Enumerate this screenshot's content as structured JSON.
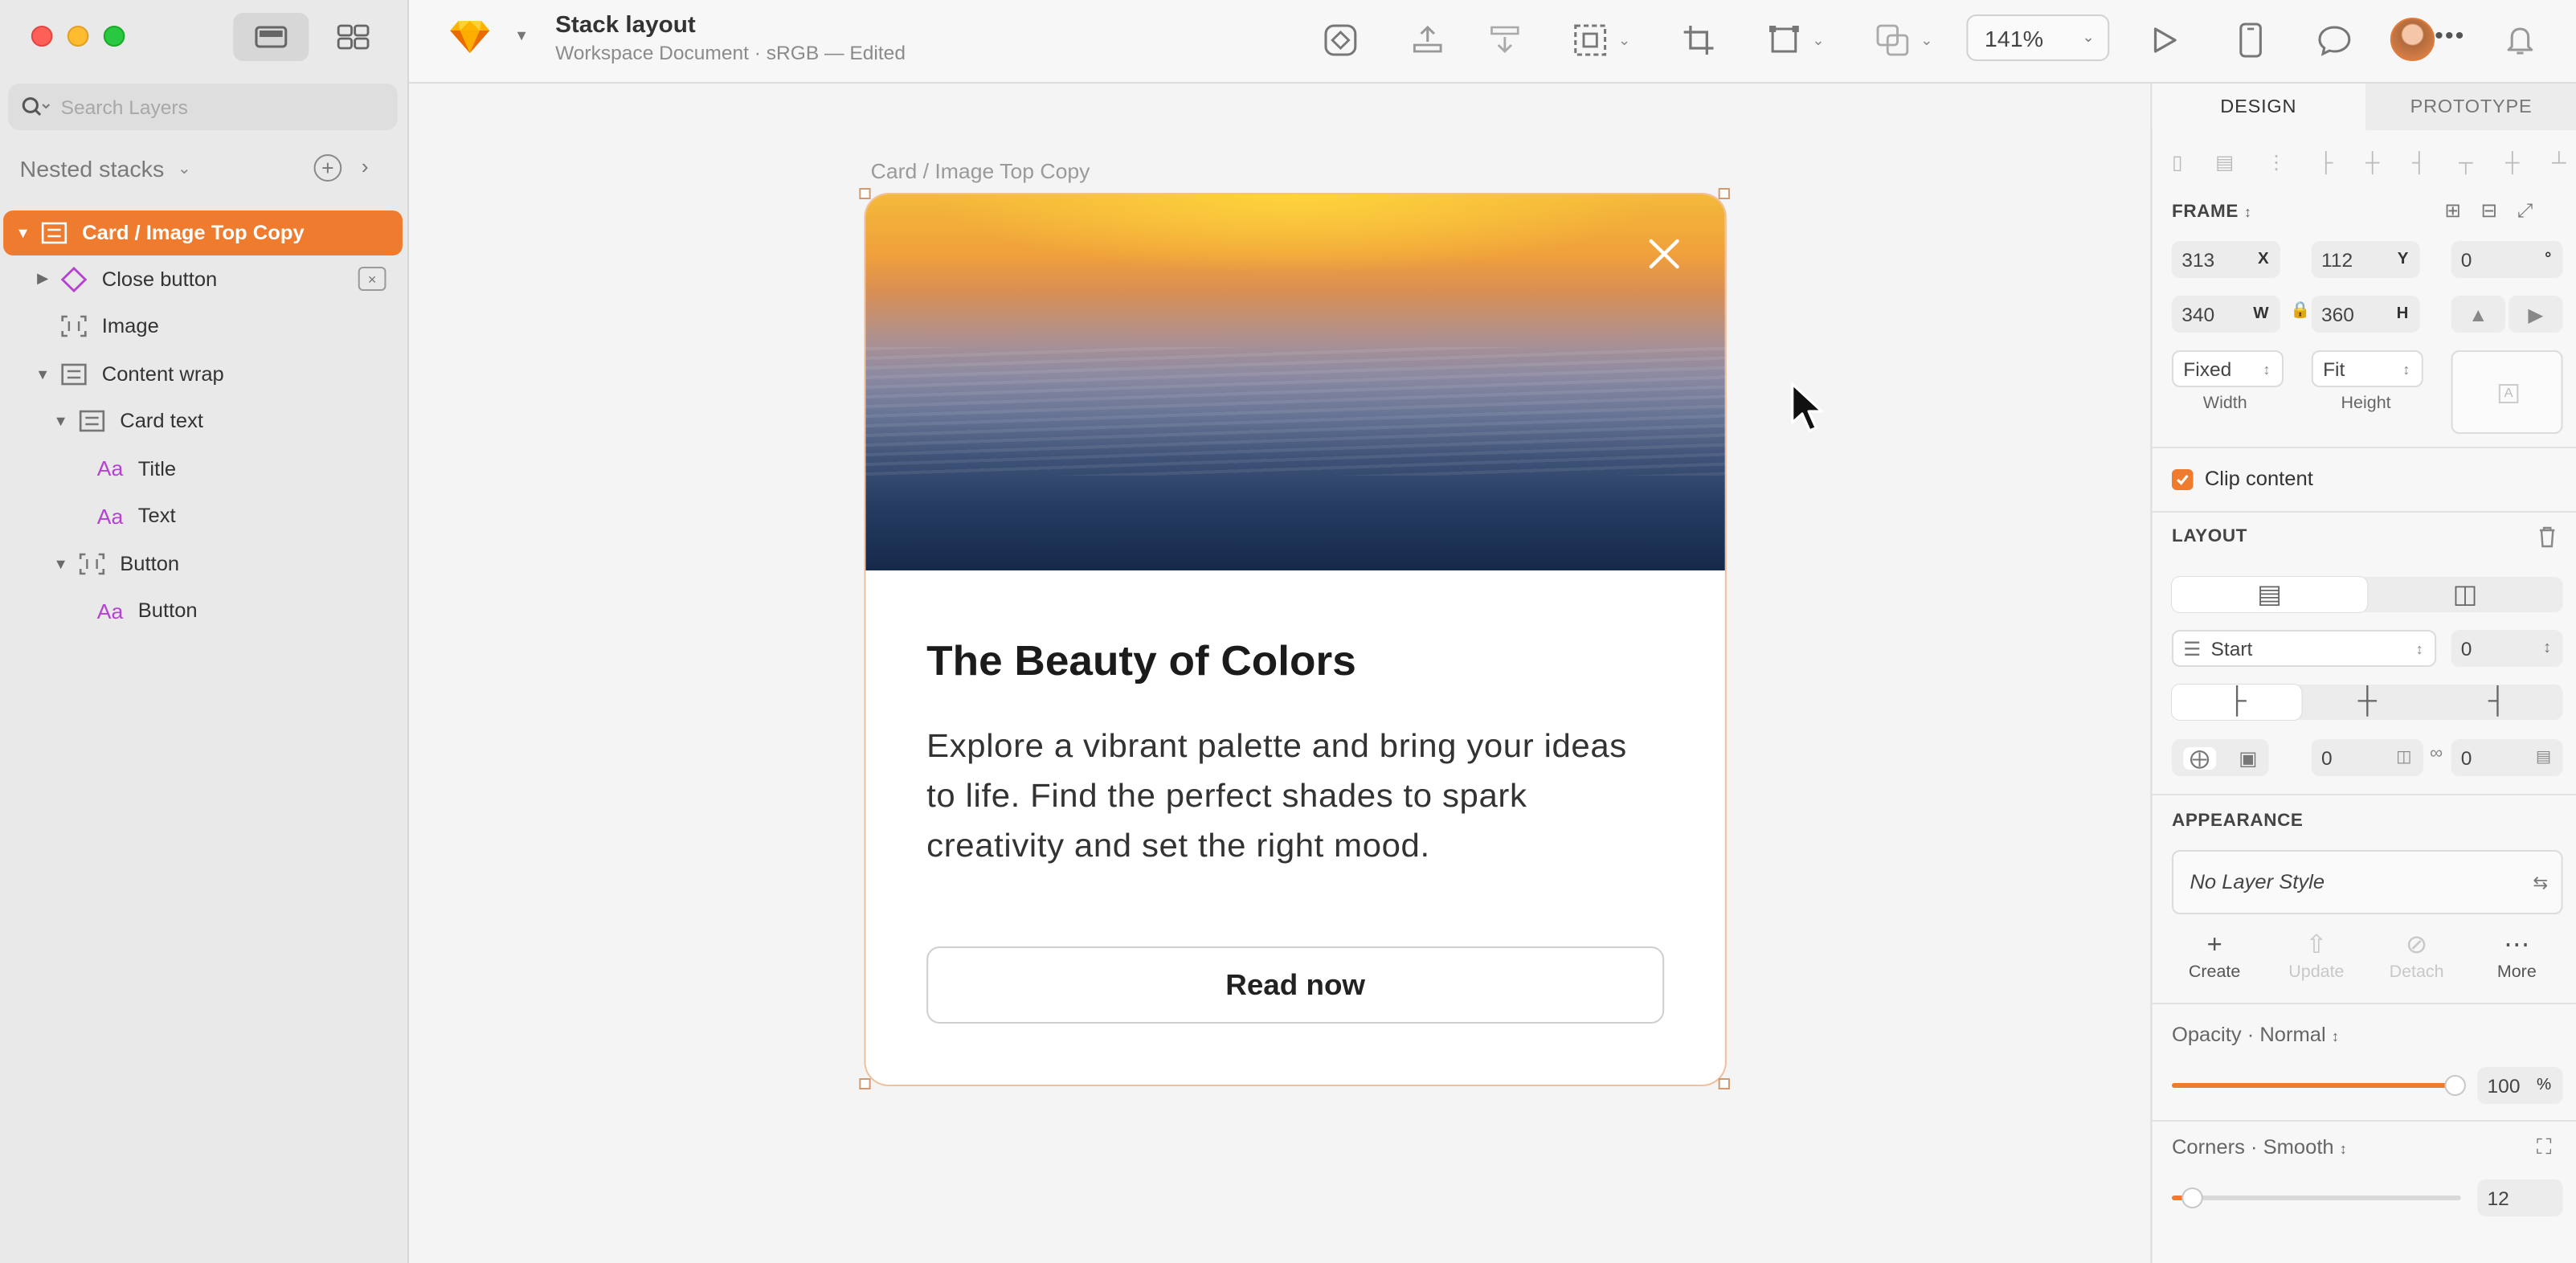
{
  "app": {
    "document_title": "Stack layout",
    "document_subtitle": "Workspace Document · sRGB — Edited",
    "zoom": "141%",
    "accent_color": "#ee7b2e"
  },
  "sidebar": {
    "search_placeholder": "Search Layers",
    "page_name": "Nested stacks",
    "layers": [
      {
        "label": "Card / Image Top Copy",
        "icon": "stack-icon",
        "selected": true
      },
      {
        "label": "Close button",
        "icon": "symbol-icon"
      },
      {
        "label": "Image",
        "icon": "image-frame-icon"
      },
      {
        "label": "Content wrap",
        "icon": "stack-icon"
      },
      {
        "label": "Card text",
        "icon": "stack-icon"
      },
      {
        "label": "Title",
        "icon": "text-icon"
      },
      {
        "label": "Text",
        "icon": "text-icon"
      },
      {
        "label": "Button",
        "icon": "frame-icon"
      },
      {
        "label": "Button",
        "icon": "text-icon"
      }
    ],
    "text_icon_glyph": "Aa"
  },
  "canvas": {
    "frame_label": "Card / Image Top Copy",
    "card": {
      "title": "The Beauty of Colors",
      "text": "Explore a vibrant palette and bring your ideas to life. Find the perfect shades to spark creativity and set the right mood.",
      "button_label": "Read now"
    }
  },
  "inspector": {
    "tabs": [
      "DESIGN",
      "PROTOTYPE"
    ],
    "frame": {
      "label": "FRAME",
      "x": "313",
      "x_label": "X",
      "y": "112",
      "y_label": "Y",
      "rotation": "0",
      "rotation_suffix": "°",
      "w": "340",
      "w_label": "W",
      "h": "360",
      "h_label": "H",
      "width_mode": "Fixed",
      "height_mode": "Fit",
      "width_caption": "Width",
      "height_caption": "Height"
    },
    "clip_content": "Clip content",
    "layout": {
      "label": "LAYOUT",
      "justify": "Start",
      "gap": "0",
      "padding_h": "0",
      "padding_v": "0"
    },
    "appearance": {
      "label": "APPEARANCE",
      "style": "No Layer Style",
      "actions": [
        "Create",
        "Update",
        "Detach",
        "More"
      ]
    },
    "opacity": {
      "label": "Opacity · Normal",
      "value": "100",
      "unit": "%",
      "level": 1.0
    },
    "corners": {
      "label": "Corners · Smooth",
      "value": "12",
      "level": 0.07
    }
  }
}
